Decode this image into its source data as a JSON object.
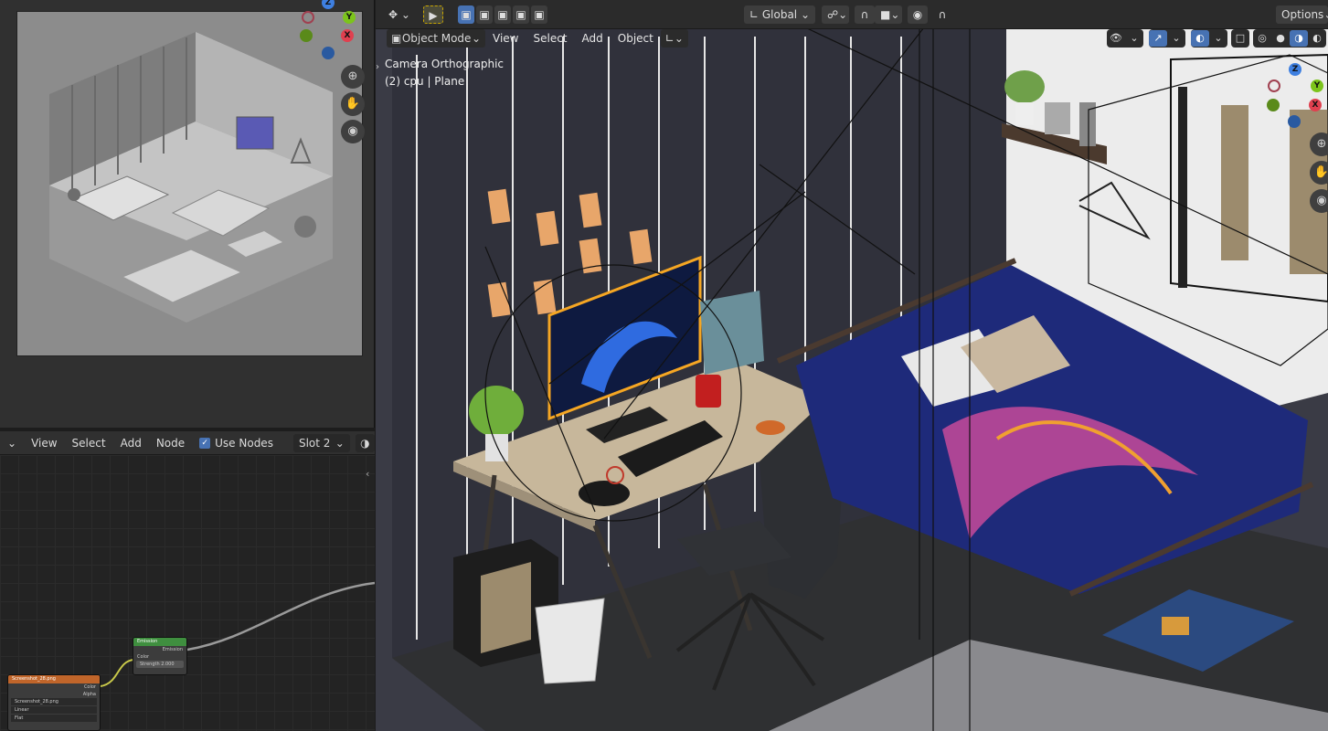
{
  "preview_gizmo": {
    "z": "Z",
    "y": "Y",
    "x": "X"
  },
  "node_header": {
    "menus": [
      "View",
      "Select",
      "Add",
      "Node"
    ],
    "use_nodes_label": "Use Nodes",
    "slot": "Slot 2"
  },
  "nodes": {
    "emission": {
      "title": "Emission",
      "output": "Emission",
      "input_color": "Color",
      "strength_label": "Strength",
      "strength_value": "2.000"
    },
    "image": {
      "title": "Screenshot_28.png",
      "out_color": "Color",
      "out_alpha": "Alpha",
      "file": "Screenshot_28.png",
      "interp": "Linear",
      "proj": "Flat"
    }
  },
  "toolbar": {
    "transform_orientation": "Global",
    "options": "Options"
  },
  "viewport_header": {
    "mode": "Object Mode",
    "menus": [
      "View",
      "Select",
      "Add",
      "Object"
    ]
  },
  "viewport_info": {
    "camera": "Camera Orthographic",
    "collection": "(2) cpu | Plane"
  },
  "nav_gizmo": {
    "z": "Z",
    "y": "Y",
    "x": "X"
  },
  "colors": {
    "accent": "#4772b3",
    "x_axis": "#e0404f",
    "y_axis": "#7cc41c",
    "z_axis": "#3e7fe0",
    "node_emission": "#3f8f3f",
    "node_image": "#c0652a",
    "selection": "#f5a623"
  }
}
